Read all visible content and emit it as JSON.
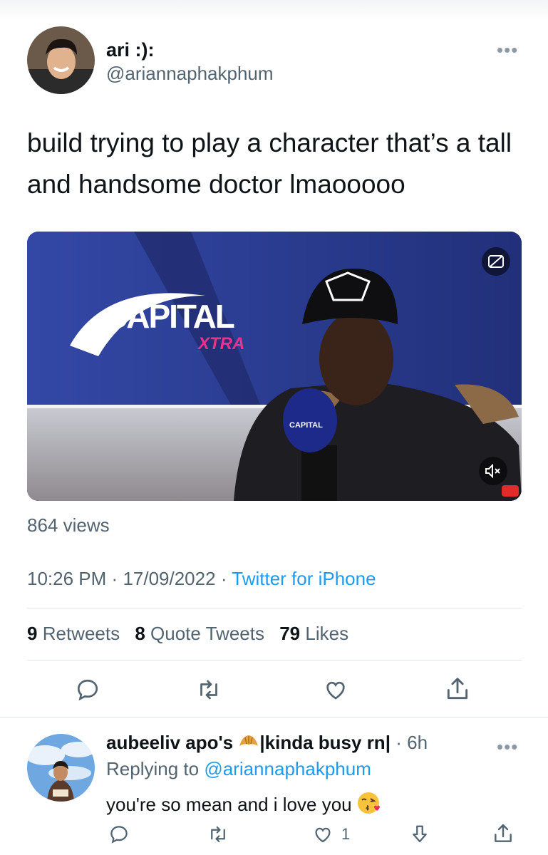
{
  "tweet": {
    "author_name": "ari :):",
    "author_handle": "@ariannaphakphum",
    "text": "build trying to play a character that’s a tall and handsome doctor lmaooooo",
    "views": "864 views",
    "time": "10:26 PM",
    "date": "17/09/2022",
    "source": "Twitter for iPhone",
    "separator": "·",
    "stats": {
      "retweets_count": "9",
      "retweets_label": "Retweets",
      "quotes_count": "8",
      "quotes_label": "Quote Tweets",
      "likes_count": "79",
      "likes_label": "Likes"
    },
    "media": {
      "logo_main": "CAPITAL",
      "logo_sub": "XTRA",
      "mic_label": "CAPITAL"
    },
    "actions": [
      "reply-icon",
      "retweet-icon",
      "like-icon",
      "share-icon"
    ]
  },
  "reply": {
    "name_part1": "aubeeliv apo's",
    "name_part2": "|kinda busy rn|",
    "time": "6h",
    "replying_prefix": "Replying to",
    "replying_to": "@ariannaphakphum",
    "text": "you're so mean and i love you",
    "likes_count": "1",
    "actions": [
      "reply-icon",
      "retweet-icon",
      "like-icon",
      "downvote-icon",
      "share-icon"
    ]
  },
  "colors": {
    "link": "#1d9bf0",
    "muted": "#536471",
    "divider": "#e1e5e8"
  }
}
